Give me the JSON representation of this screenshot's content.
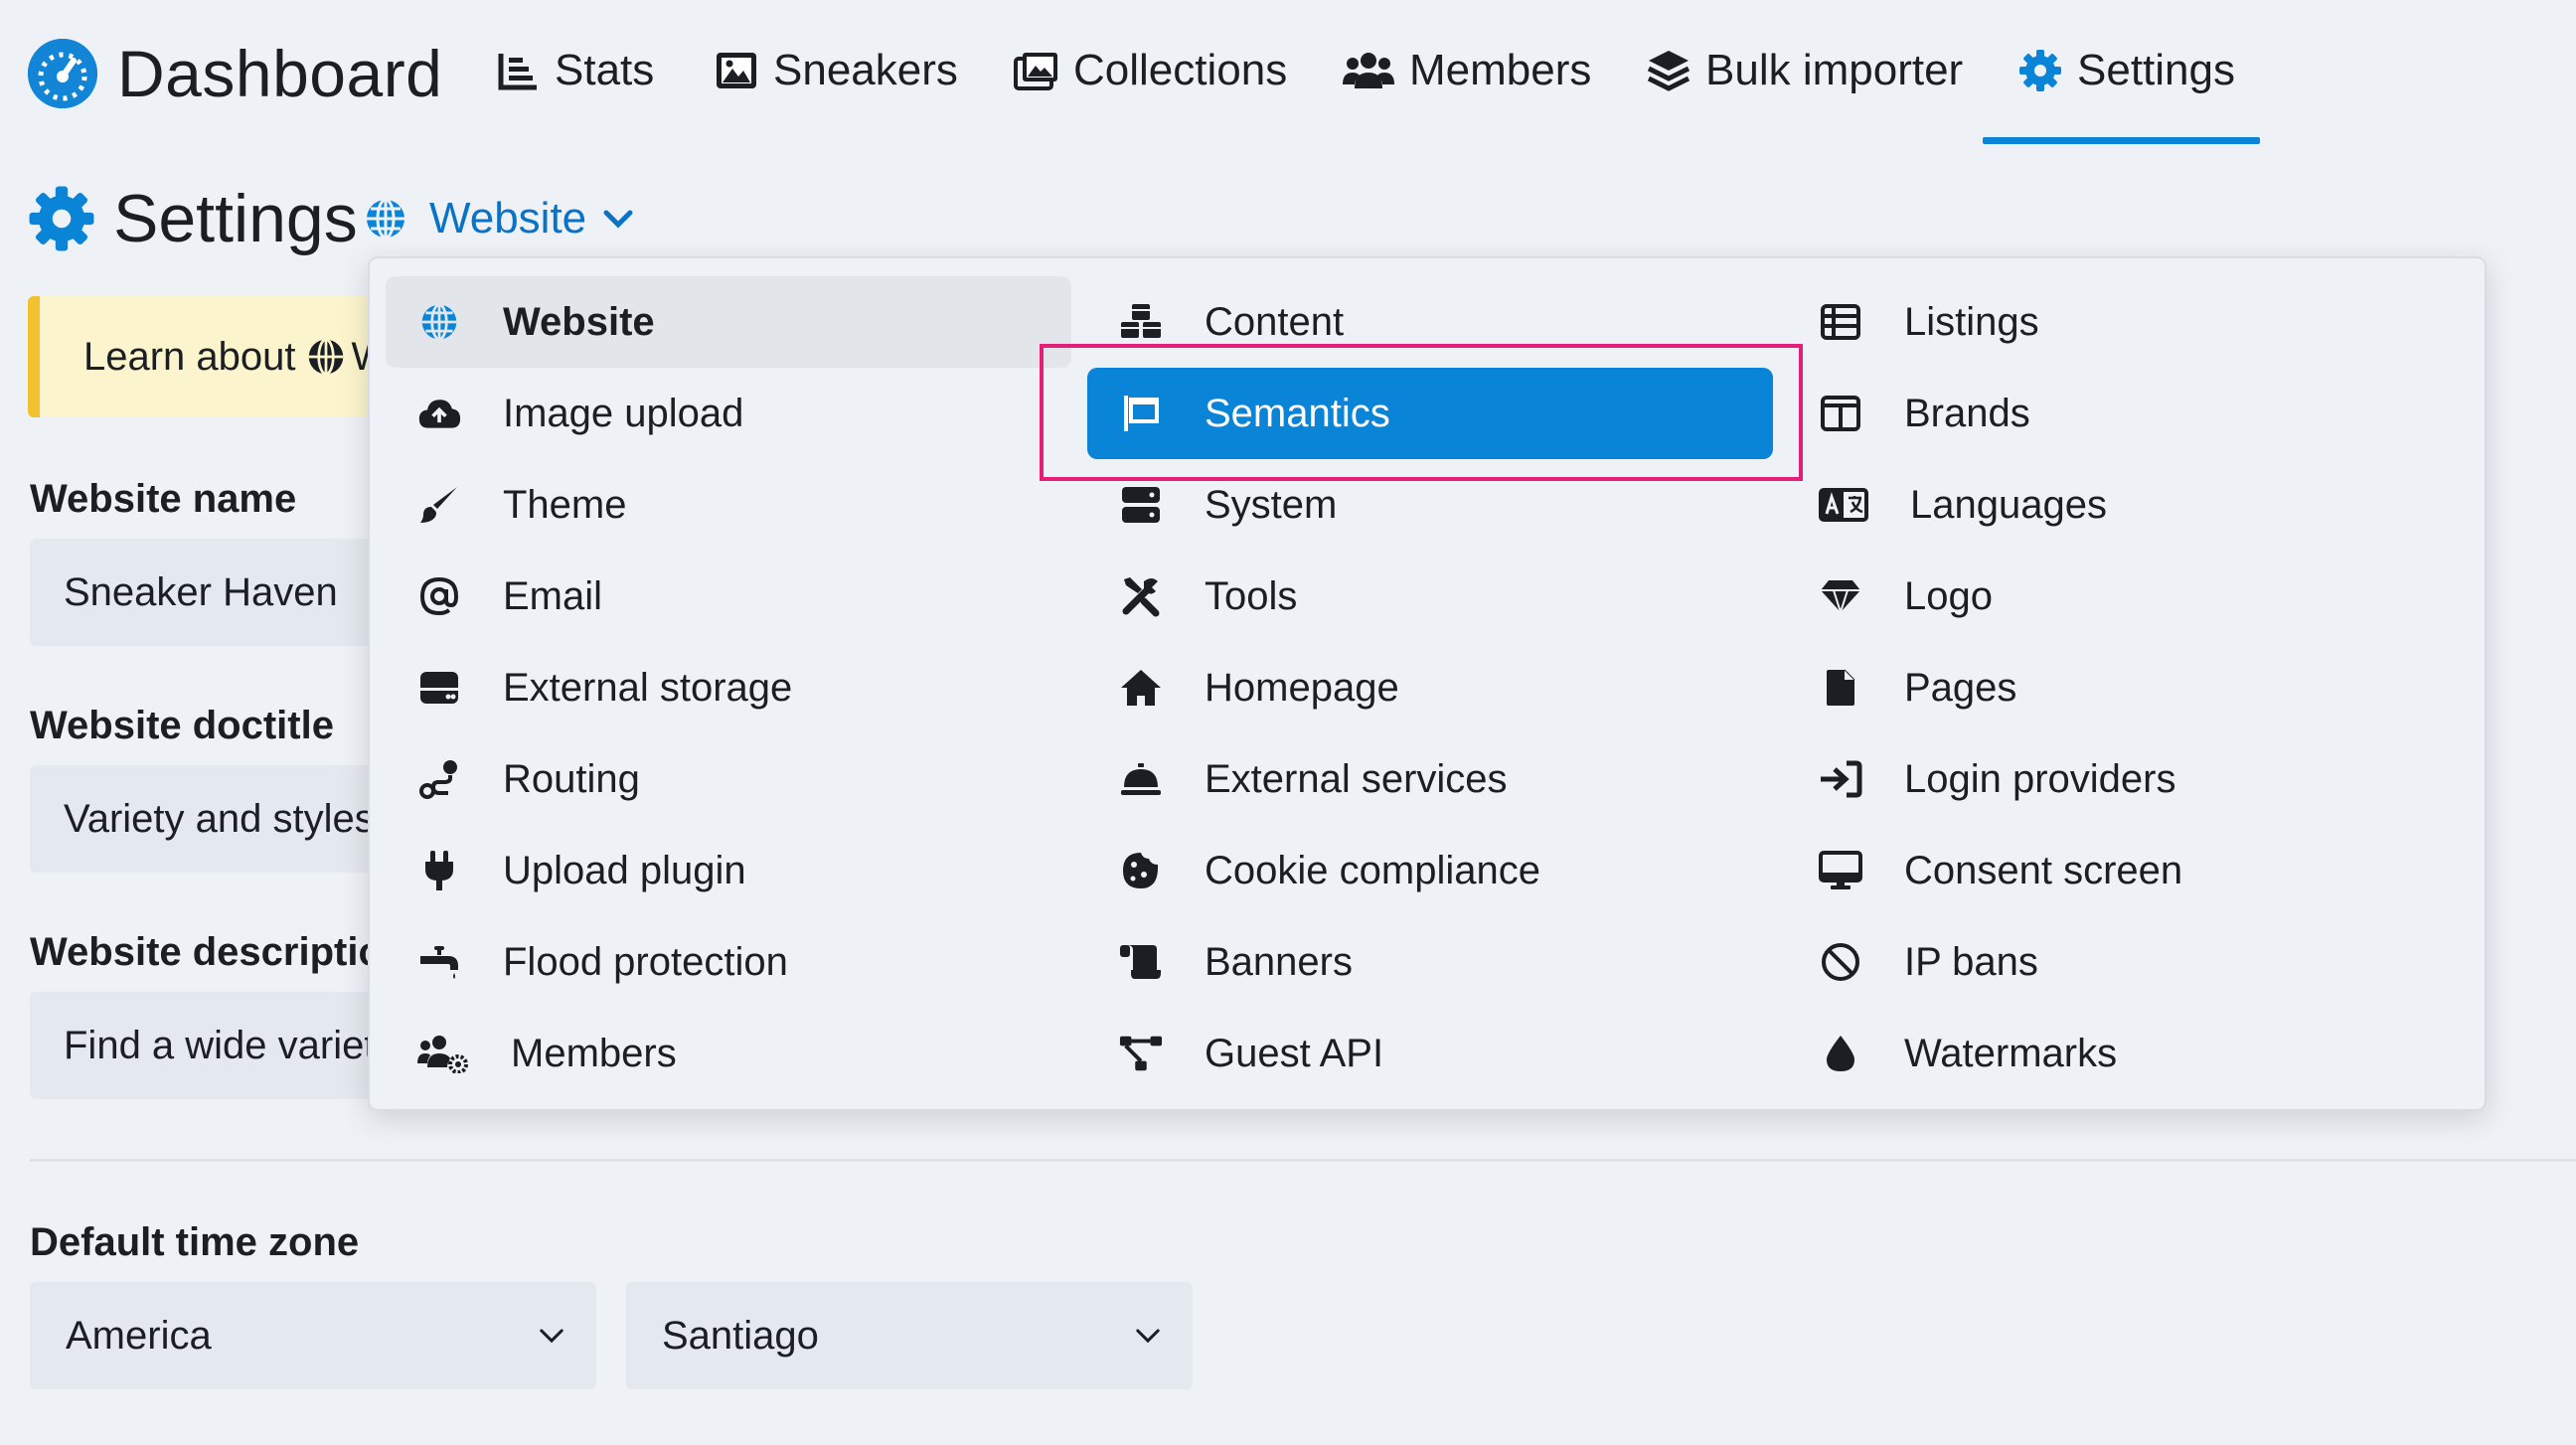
{
  "app": {
    "title": "Dashboard",
    "logo_icon": "gauge-icon"
  },
  "nav": {
    "items": [
      {
        "label": "Stats",
        "icon": "chart-icon"
      },
      {
        "label": "Sneakers",
        "icon": "image-icon"
      },
      {
        "label": "Collections",
        "icon": "images-icon"
      },
      {
        "label": "Members",
        "icon": "users-icon"
      },
      {
        "label": "Bulk importer",
        "icon": "layers-icon"
      },
      {
        "label": "Settings",
        "icon": "gear-icon",
        "active": true
      }
    ]
  },
  "page": {
    "title": "Settings",
    "section_selector": "Website"
  },
  "notice": {
    "text_before": "Learn about",
    "text_after": "W"
  },
  "form": {
    "website_name_label": "Website name",
    "website_name_value": "Sneaker Haven",
    "website_doctitle_label": "Website doctitle",
    "website_doctitle_value": "Variety and styles",
    "website_description_label": "Website descriptio",
    "website_description_value": "Find a wide variet",
    "time_zone_label": "Default time zone",
    "time_zone_region": "America",
    "time_zone_city": "Santiago"
  },
  "menu": {
    "columns": [
      [
        {
          "label": "Website",
          "icon": "globe-icon",
          "state": "current"
        },
        {
          "label": "Image upload",
          "icon": "cloud-upload-icon"
        },
        {
          "label": "Theme",
          "icon": "brush-icon"
        },
        {
          "label": "Email",
          "icon": "at-icon"
        },
        {
          "label": "External storage",
          "icon": "hard-drive-icon"
        },
        {
          "label": "Routing",
          "icon": "route-icon"
        },
        {
          "label": "Upload plugin",
          "icon": "plug-icon"
        },
        {
          "label": "Flood protection",
          "icon": "faucet-icon"
        },
        {
          "label": "Members",
          "icon": "users-cog-icon"
        }
      ],
      [
        {
          "label": "Content",
          "icon": "cubes-icon"
        },
        {
          "label": "Semantics",
          "icon": "flag-icon",
          "state": "highlighted"
        },
        {
          "label": "System",
          "icon": "server-icon"
        },
        {
          "label": "Tools",
          "icon": "tools-icon"
        },
        {
          "label": "Homepage",
          "icon": "home-icon"
        },
        {
          "label": "External services",
          "icon": "bell-concierge-icon"
        },
        {
          "label": "Cookie compliance",
          "icon": "cookie-icon"
        },
        {
          "label": "Banners",
          "icon": "scroll-icon"
        },
        {
          "label": "Guest API",
          "icon": "network-icon"
        }
      ],
      [
        {
          "label": "Listings",
          "icon": "table-list-icon"
        },
        {
          "label": "Brands",
          "icon": "columns-icon"
        },
        {
          "label": "Languages",
          "icon": "language-icon"
        },
        {
          "label": "Logo",
          "icon": "gem-icon"
        },
        {
          "label": "Pages",
          "icon": "file-icon"
        },
        {
          "label": "Login providers",
          "icon": "sign-in-icon"
        },
        {
          "label": "Consent screen",
          "icon": "desktop-icon"
        },
        {
          "label": "IP bans",
          "icon": "ban-icon"
        },
        {
          "label": "Watermarks",
          "icon": "droplet-icon"
        }
      ]
    ]
  },
  "colors": {
    "accent": "#0a84d6",
    "highlight_border": "#e51f78",
    "notice_bar": "#f2c12e"
  }
}
